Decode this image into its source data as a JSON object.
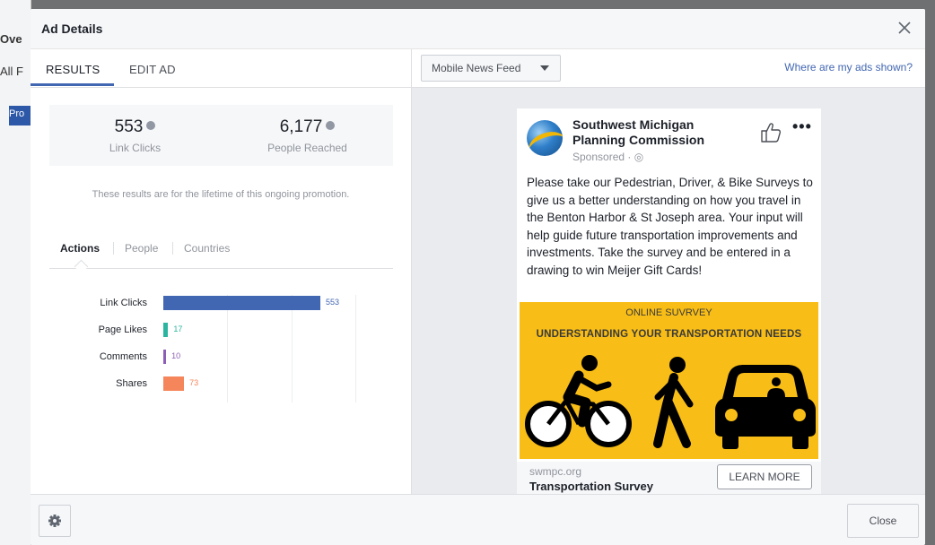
{
  "background": {
    "left_text_1": "Ove",
    "left_text_2": "All F",
    "left_text_3": "Pro"
  },
  "modal": {
    "title": "Ad Details",
    "close_icon": "close-icon"
  },
  "tabs": [
    {
      "label": "RESULTS",
      "active": true
    },
    {
      "label": "EDIT AD",
      "active": false
    }
  ],
  "stats": [
    {
      "value": "553",
      "label": "Link Clicks"
    },
    {
      "value": "6,177",
      "label": "People Reached"
    }
  ],
  "lifetime_note": "These results are for the lifetime of this ongoing promotion.",
  "subtabs": [
    {
      "label": "Actions",
      "active": true
    },
    {
      "label": "People",
      "active": false
    },
    {
      "label": "Countries",
      "active": false
    }
  ],
  "chart_data": {
    "type": "bar",
    "orientation": "horizontal",
    "categories": [
      "Link Clicks",
      "Page Likes",
      "Comments",
      "Shares"
    ],
    "values": [
      553,
      17,
      10,
      73
    ],
    "colors": [
      "#4267b2",
      "#2bb5a0",
      "#8c5fb7",
      "#f5865b"
    ],
    "xlim": [
      0,
      600
    ],
    "grid": true
  },
  "preview": {
    "placement": "Mobile News Feed",
    "where_link": "Where are my ads shown?"
  },
  "post": {
    "page_name": "Southwest Michigan Planning Commission",
    "sponsored": "Sponsored · ◎",
    "text": "Please take our Pedestrian, Driver, & Bike Surveys to give us a better understanding on how you travel in the Benton Harbor & St Joseph area. Your input will help guide future transportation improvements and investments. Take the survey and be entered in a drawing to win Meijer Gift Cards!",
    "creative_line1": "ONLINE SUVRVEY",
    "creative_line2": "UNDERSTANDING YOUR TRANSPORTATION NEEDS",
    "creative_bg": "#f8bd16",
    "domain": "swmpc.org",
    "link_title": "Transportation Survey",
    "cta": "LEARN MORE"
  },
  "footer": {
    "settings_icon": "gear-icon",
    "close_label": "Close"
  },
  "accent": "#4267b2"
}
